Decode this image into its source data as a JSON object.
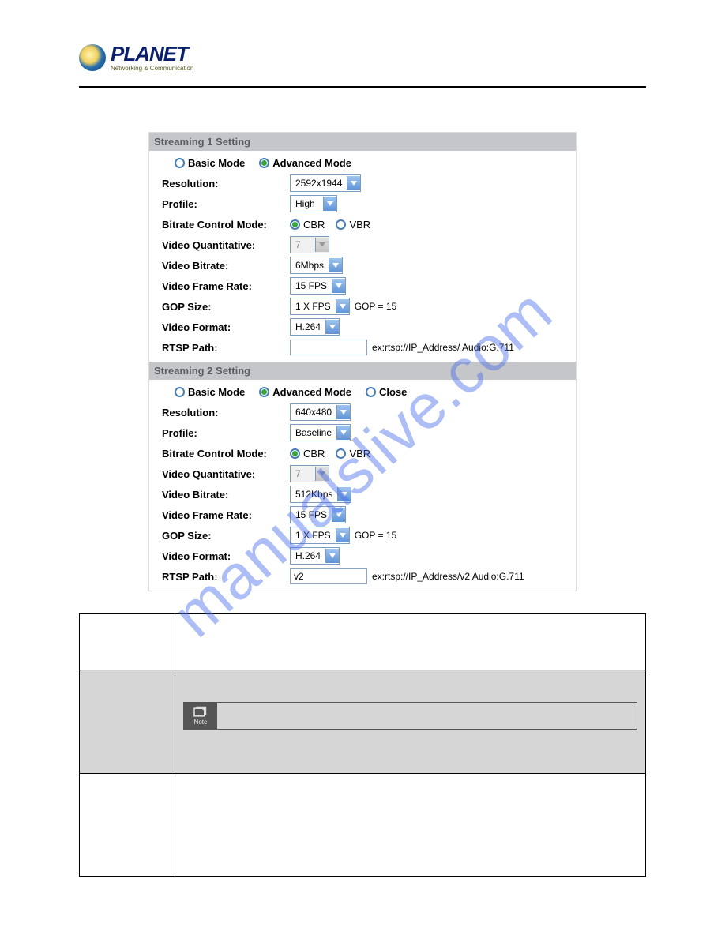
{
  "logo": {
    "brand": "PLANET",
    "tagline": "Networking & Communication"
  },
  "watermark": "manualslive.com",
  "panel": {
    "s1": {
      "header": "Streaming 1 Setting",
      "basic": "Basic Mode",
      "advanced": "Advanced Mode",
      "labels": {
        "resolution": "Resolution:",
        "profile": "Profile:",
        "bitrate_mode": "Bitrate Control Mode:",
        "video_quant": "Video Quantitative:",
        "video_bitrate": "Video Bitrate:",
        "frame_rate": "Video Frame Rate:",
        "gop_size": "GOP Size:",
        "video_format": "Video Format:",
        "rtsp_path": "RTSP Path:"
      },
      "values": {
        "resolution": "2592x1944",
        "profile": "High",
        "cbr": "CBR",
        "vbr": "VBR",
        "video_quant": "7",
        "video_bitrate": "6Mbps",
        "frame_rate": "15 FPS",
        "gop_size": "1 X FPS",
        "gop_eq": "GOP = 15",
        "video_format": "H.264",
        "rtsp_value": "",
        "rtsp_hint": "ex:rtsp://IP_Address/   Audio:G.711"
      }
    },
    "s2": {
      "header": "Streaming 2 Setting",
      "basic": "Basic Mode",
      "advanced": "Advanced Mode",
      "close": "Close",
      "labels": {
        "resolution": "Resolution:",
        "profile": "Profile:",
        "bitrate_mode": "Bitrate Control Mode:",
        "video_quant": "Video Quantitative:",
        "video_bitrate": "Video Bitrate:",
        "frame_rate": "Video Frame Rate:",
        "gop_size": "GOP Size:",
        "video_format": "Video Format:",
        "rtsp_path": "RTSP Path:"
      },
      "values": {
        "resolution": "640x480",
        "profile": "Baseline",
        "cbr": "CBR",
        "vbr": "VBR",
        "video_quant": "7",
        "video_bitrate": "512Kbps",
        "frame_rate": "15 FPS",
        "gop_size": "1 X FPS",
        "gop_eq": "GOP = 15",
        "video_format": "H.264",
        "rtsp_value": "v2",
        "rtsp_hint": "ex:rtsp://IP_Address/v2   Audio:G.711"
      }
    }
  },
  "note": {
    "label": "Note"
  }
}
